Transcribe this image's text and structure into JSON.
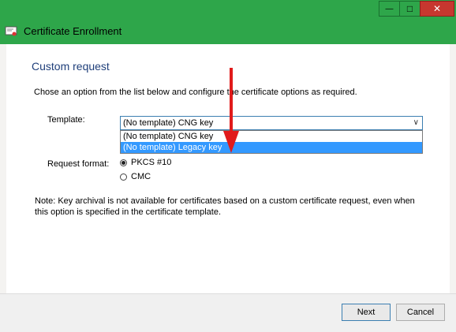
{
  "window": {
    "title": "Certificate Enrollment",
    "controls": {
      "minimize": "—",
      "maximize": "□",
      "close": "✕"
    }
  },
  "page": {
    "heading": "Custom request",
    "description": "Chose an option from the list below and configure the certificate options as required.",
    "template_label": "Template:",
    "template_selected": "(No template) CNG key",
    "template_options": [
      "(No template) CNG key",
      "(No template) Legacy key"
    ],
    "request_format_label": "Request format:",
    "formats": [
      {
        "label": "PKCS #10",
        "checked": true
      },
      {
        "label": "CMC",
        "checked": false
      }
    ],
    "note": "Note: Key archival is not available for certificates based on a custom certificate request, even when this option is specified in the certificate template."
  },
  "footer": {
    "next_label": "Next",
    "cancel_label": "Cancel"
  },
  "colors": {
    "accent": "#2ea64a",
    "heading": "#1f3f7a",
    "highlight": "#3399ff",
    "arrow": "#e11b1b"
  }
}
